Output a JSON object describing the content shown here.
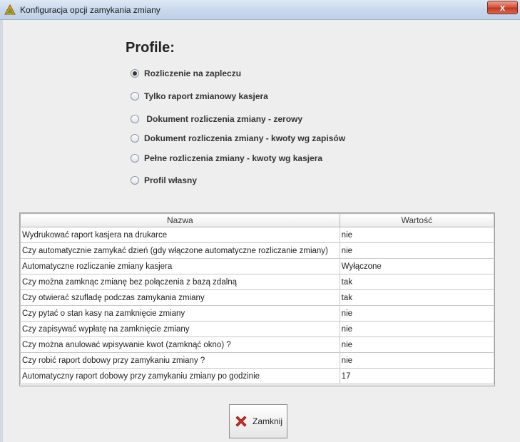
{
  "window": {
    "title": "Konfiguracja opcji zamykania zmiany",
    "close_glyph": "x"
  },
  "profiles": {
    "title": "Profile:",
    "options": [
      {
        "label": "Rozliczenie na zapleczu",
        "checked": true
      },
      {
        "label": "Tylko raport zmianowy kasjera",
        "checked": false
      },
      {
        "label": " Dokument rozliczenia zmiany - zerowy",
        "checked": false
      },
      {
        "label": "Dokument rozliczenia zmiany - kwoty wg zapisów",
        "checked": false
      },
      {
        "label": "Pełne rozliczenia zmiany - kwoty wg kasjera",
        "checked": false
      },
      {
        "label": "Profil własny",
        "checked": false
      }
    ]
  },
  "table": {
    "headers": {
      "name": "Nazwa",
      "value": "Wartość"
    },
    "rows": [
      {
        "name": "Wydrukować raport kasjera na drukarce",
        "value": "nie"
      },
      {
        "name": "Czy automatycznie zamykać dzień (gdy włączone automatyczne rozliczanie zmiany)",
        "value": "nie"
      },
      {
        "name": "Automatyczne rozliczanie zmiany kasjera",
        "value": "Wyłączone"
      },
      {
        "name": "Czy można zamknąc zmianę bez połączenia z bazą zdalną",
        "value": "tak"
      },
      {
        "name": "Czy otwierać szufladę podczas zamykania zmiany",
        "value": "tak"
      },
      {
        "name": "Czy pytać o stan kasy na zamknięcie zmiany",
        "value": "nie"
      },
      {
        "name": "Czy zapisywać wypłatę na zamknięcie zmiany",
        "value": "nie"
      },
      {
        "name": "Czy można anulować wpisywanie kwot (zamknąć okno) ?",
        "value": "nie"
      },
      {
        "name": "Czy robić raport dobowy przy zamykaniu zmiany ?",
        "value": "nie"
      },
      {
        "name": "Automatyczny raport dobowy przy zamykaniu zmiany po godzinie",
        "value": "17"
      }
    ]
  },
  "footer": {
    "close_label": "Zamknij",
    "close_icon": "red-x-icon"
  },
  "colors": {
    "close_icon": "#d42a1f",
    "title_icon": "#e0a020"
  }
}
